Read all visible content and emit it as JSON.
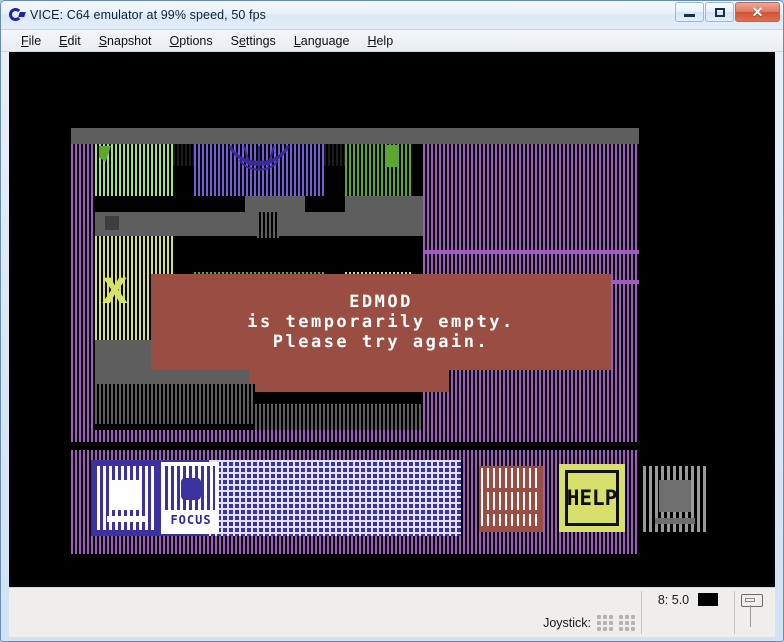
{
  "window": {
    "title": "VICE: C64 emulator at 99% speed, 50 fps",
    "app_icon": "vice-commodore-icon",
    "minimize_label": "",
    "maximize_label": "",
    "close_label": "✕"
  },
  "menubar": {
    "items": [
      {
        "label": "File",
        "mnemonic": "F"
      },
      {
        "label": "Edit",
        "mnemonic": "E"
      },
      {
        "label": "Snapshot",
        "mnemonic": "S"
      },
      {
        "label": "Options",
        "mnemonic": "O"
      },
      {
        "label": "Settings",
        "mnemonic": "e"
      },
      {
        "label": "Language",
        "mnemonic": "L"
      },
      {
        "label": "Help",
        "mnemonic": "H"
      }
    ]
  },
  "emulator": {
    "background_color": "#000000",
    "dialog": {
      "background_color": "#9a4d43",
      "text_color": "#ffffff",
      "line1": "EDMOD",
      "line2": "is temporarily empty.",
      "line3": "Please try again."
    },
    "tiles": [
      {
        "name": "selector-tile",
        "label": "",
        "color": "#3b32a0"
      },
      {
        "name": "focus-tile",
        "label": "FOCUS",
        "color": "#ffffff"
      },
      {
        "name": "grid-tile",
        "label": "",
        "color": "#4a41aa"
      },
      {
        "name": "inventory-tile",
        "label": "",
        "color": "#9a4d43"
      },
      {
        "name": "help-tile",
        "label": "HELP",
        "color": "#d7e06a"
      },
      {
        "name": "system-tile",
        "label": "",
        "color": "#6e6e6e"
      }
    ],
    "palette": {
      "black": "#000000",
      "grey": "#5e5e5e",
      "light_grey": "#9a9a9a",
      "purple": "#a05ac0",
      "blue_violet": "#7a5ad8",
      "light_green": "#a8e078",
      "green": "#5aa832",
      "yellow": "#d7e06a",
      "brown_red": "#9a4d43",
      "blue": "#3b32a0",
      "white": "#ffffff"
    }
  },
  "statusbar": {
    "joystick_label": "Joystick:",
    "joystick_ports": 2,
    "drive_label": "8: 5.0",
    "drive_led_color": "#000000",
    "tape_icon": "datasette-icon"
  }
}
